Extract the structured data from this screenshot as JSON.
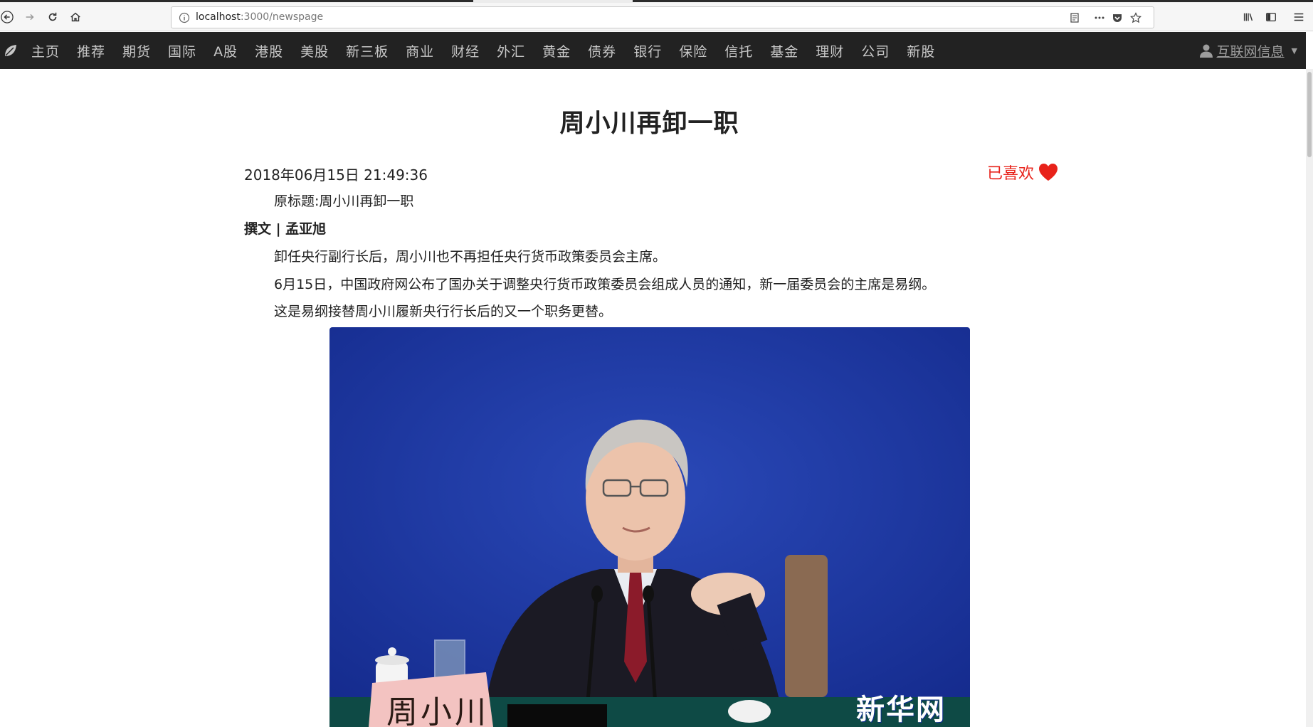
{
  "browser": {
    "url_host": "localhost",
    "url_path": ":3000/newspage"
  },
  "nav": {
    "items": [
      "主页",
      "推荐",
      "期货",
      "国际",
      "A股",
      "港股",
      "美股",
      "新三板",
      "商业",
      "财经",
      "外汇",
      "黄金",
      "债券",
      "银行",
      "保险",
      "信托",
      "基金",
      "理财",
      "公司",
      "新股"
    ],
    "user_label": "互联网信息"
  },
  "article": {
    "title": "周小川再卸一职",
    "datetime": "2018年06月15日 21:49:36",
    "liked_label": "已喜欢",
    "original_title": "原标题:周小川再卸一职",
    "author_line": "撰文 | 孟亚旭",
    "paragraphs": [
      "卸任央行副行长后，周小川也不再担任央行货币政策委员会主席。",
      "6月15日，中国政府网公布了国办关于调整央行货币政策委员会组成人员的通知，新一届委员会的主席是易纲。",
      "这是易纲接替周小川履新央行行长后的又一个职务更替。"
    ],
    "photo": {
      "nameplate": "周小川",
      "watermark": "新华网"
    }
  },
  "colors": {
    "navbar_bg": "#222222",
    "liked_red": "#e8221a",
    "photo_blue": "#1f3aa8"
  }
}
